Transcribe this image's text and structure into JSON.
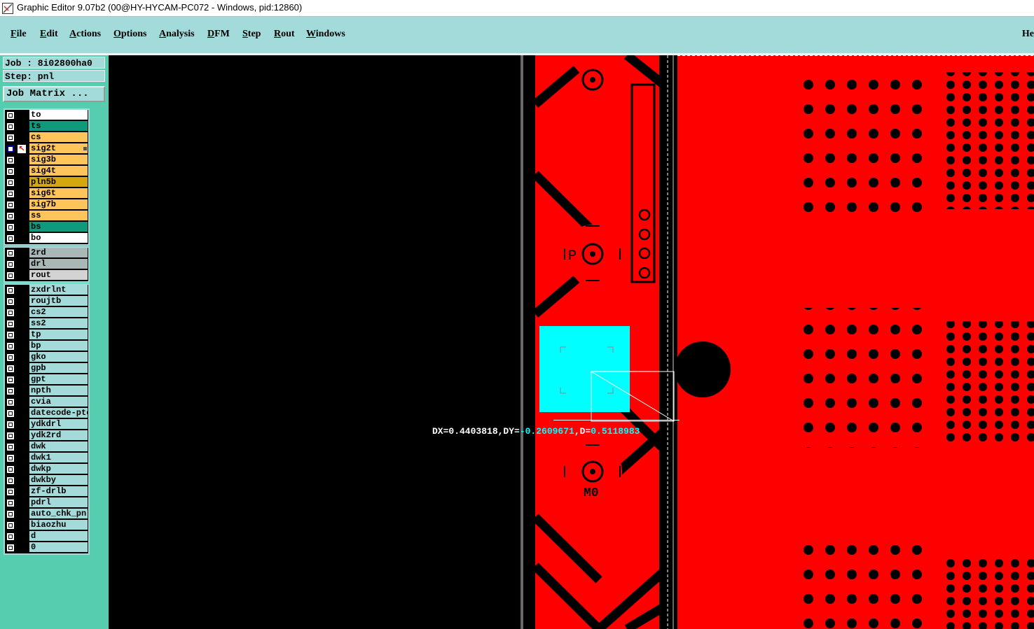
{
  "window": {
    "title": "Graphic Editor 9.07b2 (00@HY-HYCAM-PC072 - Windows, pid:12860)"
  },
  "menu": {
    "items": [
      "File",
      "Edit",
      "Actions",
      "Options",
      "Analysis",
      "DFM",
      "Step",
      "Rout",
      "Windows"
    ],
    "help_truncated": "He"
  },
  "job": {
    "job_label": "Job : 8i02800ha0",
    "step_label": "Step: pnl",
    "matrix_button": "Job Matrix ..."
  },
  "layers": {
    "board": [
      {
        "name": "to",
        "color": "#ffffff"
      },
      {
        "name": "ts",
        "color": "#0f9a7e"
      },
      {
        "name": "cs",
        "color": "#ffc55a"
      },
      {
        "name": "sig2t",
        "color": "#ffc55a",
        "active": true,
        "pointer": "↖"
      },
      {
        "name": "sig3b",
        "color": "#ffc55a"
      },
      {
        "name": "sig4t",
        "color": "#ffc55a"
      },
      {
        "name": "pln5b",
        "color": "#d4a70f"
      },
      {
        "name": "sig6t",
        "color": "#ffc55a"
      },
      {
        "name": "sig7b",
        "color": "#ffc55a"
      },
      {
        "name": "ss",
        "color": "#ffc55a"
      },
      {
        "name": "bs",
        "color": "#0f9a7e"
      },
      {
        "name": "bo",
        "color": "#ffffff"
      }
    ],
    "drill": [
      {
        "name": "2rd",
        "color": "#a9b7b7"
      },
      {
        "name": "drl",
        "color": "#a9b7b7"
      },
      {
        "name": "rout",
        "color": "#d3d3d3"
      }
    ],
    "misc": [
      {
        "name": "zxdrlnt"
      },
      {
        "name": "roujtb"
      },
      {
        "name": "cs2"
      },
      {
        "name": "ss2"
      },
      {
        "name": "tp"
      },
      {
        "name": "bp"
      },
      {
        "name": "gko"
      },
      {
        "name": "gpb"
      },
      {
        "name": "gpt"
      },
      {
        "name": "npth"
      },
      {
        "name": "cvia"
      },
      {
        "name": "datecode-ptc"
      },
      {
        "name": "ydkdrl"
      },
      {
        "name": "ydk2rd"
      },
      {
        "name": "dwk"
      },
      {
        "name": "dwk1"
      },
      {
        "name": "dwkp"
      },
      {
        "name": "dwkby"
      },
      {
        "name": "zf-drlb"
      },
      {
        "name": "pdrl"
      },
      {
        "name": "auto_chk_pnl"
      },
      {
        "name": "biaozhu"
      },
      {
        "name": "d"
      },
      {
        "name": "0"
      }
    ],
    "misc_color": "#a3dada"
  },
  "canvas": {
    "background": "#000000",
    "copper_color": "#ff0000",
    "highlight_color": "#00ffff",
    "fiducial_labels": [
      "P",
      "M0"
    ],
    "measure": {
      "dx_text": "DX=0.4403818,DY=",
      "dy_text": "-0.2609671",
      "sep_text": ",D=",
      "d_text": "0.5118983"
    }
  }
}
